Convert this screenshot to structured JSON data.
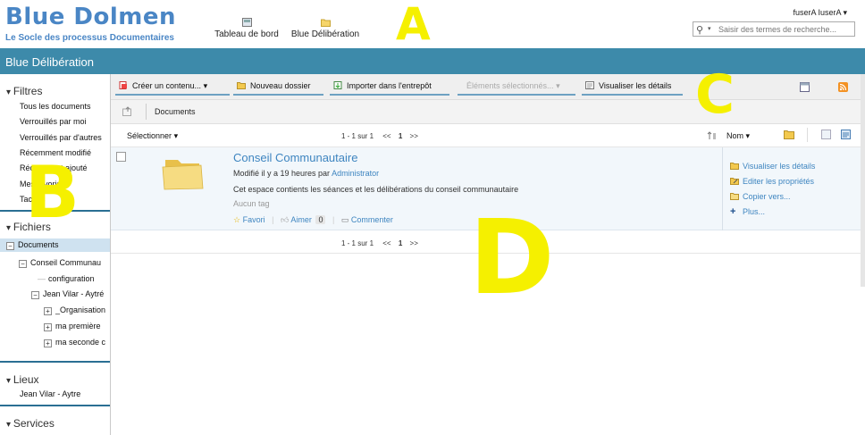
{
  "header": {
    "logo_title": "Blue Dolmen",
    "logo_subtitle": "Le Socle des processus Documentaires",
    "nav": [
      {
        "label": "Tableau de bord",
        "icon": "dashboard-icon"
      },
      {
        "label": "Blue Délibération",
        "icon": "folder-icon"
      }
    ],
    "user_menu": "fuserA IuserA ▾",
    "search_placeholder": "Saisir des termes de recherche..."
  },
  "site_title": "Blue Délibération",
  "sidebar": {
    "filters_title": "Filtres",
    "filters": [
      "Tous les documents",
      "Verrouillés par moi",
      "Verrouillés par d'autres",
      "Récemment modifié",
      "Récemment ajouté",
      "Mes favoris",
      "Taches"
    ],
    "files_title": "Fichiers",
    "tree": [
      {
        "label": "Documents",
        "toggle": "−"
      },
      {
        "label": "Conseil Communau",
        "toggle": "−"
      },
      {
        "label": "configuration",
        "toggle": ""
      },
      {
        "label": "Jean Vilar - Aytré",
        "toggle": "−"
      },
      {
        "label": "_Organisation",
        "toggle": "+"
      },
      {
        "label": "ma première",
        "toggle": "+"
      },
      {
        "label": "ma seconde c",
        "toggle": "+"
      }
    ],
    "places_title": "Lieux",
    "places": [
      "Jean Vilar - Aytre"
    ],
    "services_title": "Services"
  },
  "toolbar": {
    "create": "Créer un contenu...",
    "new_folder": "Nouveau dossier",
    "import": "Importer dans l'entrepôt",
    "selected": "Éléments sélectionnés...",
    "view_details": "Visualiser les détails"
  },
  "breadcrumb": {
    "current": "Documents"
  },
  "listbar": {
    "select": "Sélectionner",
    "sort": "Nom",
    "paging": {
      "range": "1 - 1 sur 1",
      "prev": "<<",
      "page": "1",
      "next": ">>"
    }
  },
  "item": {
    "title": "Conseil Communautaire",
    "modified_prefix": "Modifié il y a 19 heures par",
    "modified_by": "Administrator",
    "description": "Cet espace contients les séances et les délibérations du conseil communautaire",
    "tags": "Aucun tag",
    "favorite": "Favori",
    "like": "Aimer",
    "like_count": "0",
    "comment": "Commenter",
    "side_actions": [
      "Visualiser les détails",
      "Editer les propriétés",
      "Copier vers...",
      "Plus..."
    ]
  },
  "annotations": [
    "A",
    "B",
    "C",
    "D"
  ],
  "colors": {
    "accent": "#3d8aaa",
    "link": "#3e85c0",
    "annotation": "#f5f000"
  }
}
